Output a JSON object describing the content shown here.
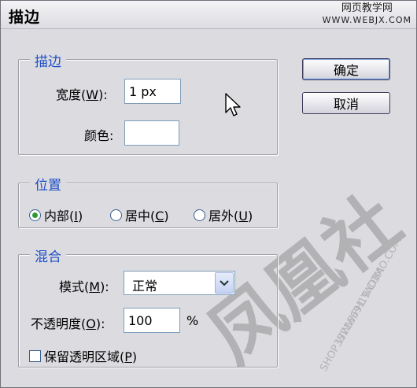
{
  "window": {
    "title": "描边"
  },
  "watermark": {
    "site_name": "网页教学网",
    "site_url": "WWW.WEBJX.COM"
  },
  "stroke": {
    "legend": "描边",
    "width_label": "宽度(",
    "width_key": "W",
    "width_label_end": "):",
    "width_value": "1 px",
    "color_label": "颜色:"
  },
  "buttons": {
    "ok": "确定",
    "cancel": "取消"
  },
  "position": {
    "legend": "位置",
    "options": [
      {
        "label": "内部(",
        "key": "I",
        "end": ")",
        "selected": true
      },
      {
        "label": "居中(",
        "key": "C",
        "end": ")",
        "selected": false
      },
      {
        "label": "居外(",
        "key": "U",
        "end": ")",
        "selected": false
      }
    ]
  },
  "blend": {
    "legend": "混合",
    "mode_label": "模式(",
    "mode_key": "M",
    "mode_label_end": "):",
    "mode_value": "正常",
    "opacity_label": "不透明度(",
    "opacity_key": "O",
    "opacity_label_end": "):",
    "opacity_value": "100",
    "opacity_unit": "%",
    "preserve_label": "保留透明区域(",
    "preserve_key": "P",
    "preserve_end": ")",
    "preserve_checked": false
  },
  "stamp": {
    "text": "凤凰社",
    "shop": "SHOP33216691.TAOBAO.COM",
    "site": "WWW.FH19.COM"
  },
  "colors": {
    "legend": "#1f4fc7",
    "dialog_bg": "#dcdce0",
    "radio_on": "#2f9a2f"
  }
}
